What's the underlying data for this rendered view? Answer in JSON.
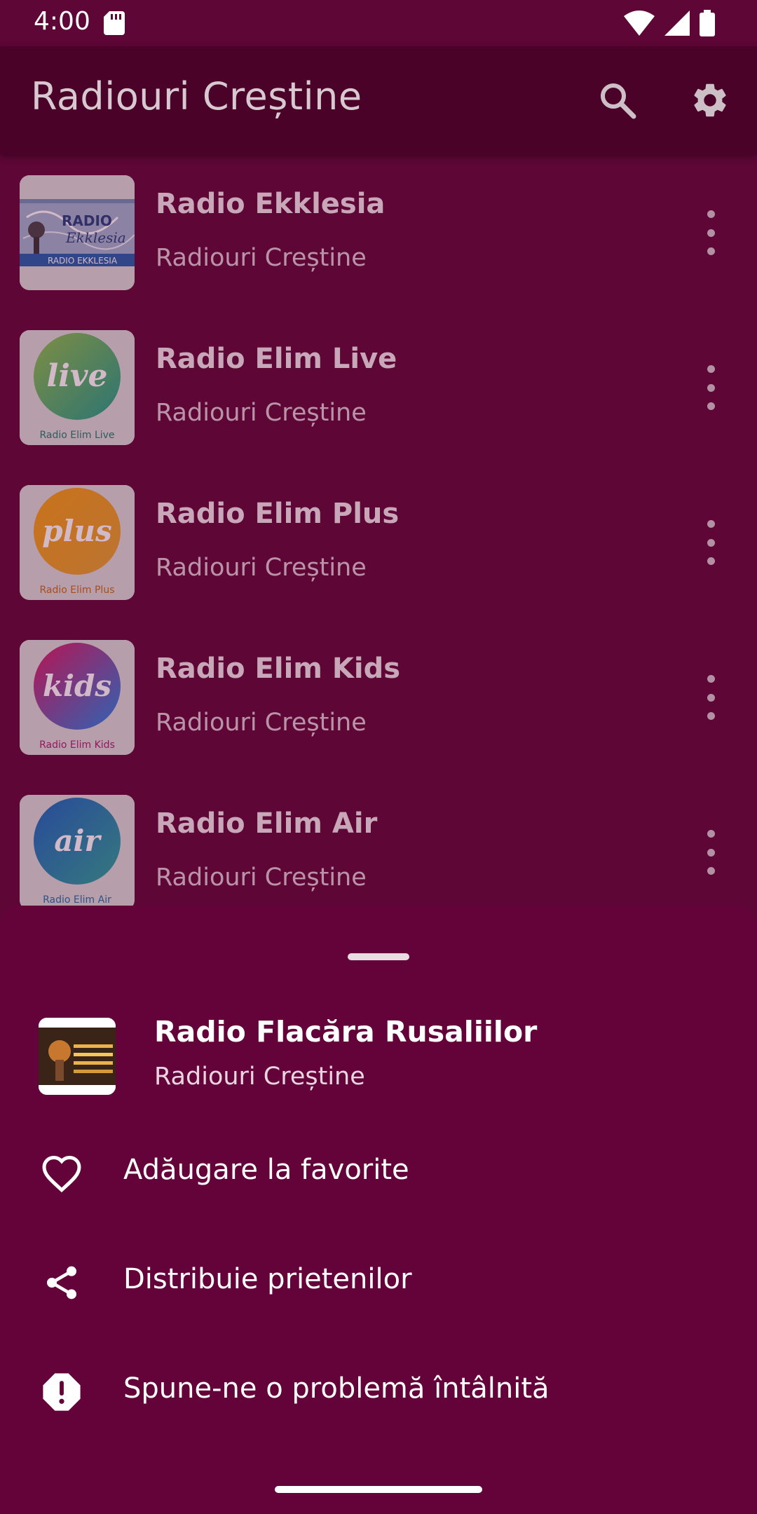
{
  "status": {
    "time": "4:00"
  },
  "app_bar": {
    "title": "Radiouri Creștine"
  },
  "stations": [
    {
      "title": "Radio Ekklesia",
      "subtitle": "Radiouri Creștine",
      "logo_text": "RADIO EKKLESIA",
      "logo_color": "#1f5fa8"
    },
    {
      "title": "Radio Elim Live",
      "subtitle": "Radiouri Creștine",
      "logo_word": "live",
      "logo_caption": "Radio Elim Live",
      "logo_color": "#4caf50"
    },
    {
      "title": "Radio Elim Plus",
      "subtitle": "Radiouri Creștine",
      "logo_word": "plus",
      "logo_caption": "Radio Elim Plus",
      "logo_color": "#f08a1c"
    },
    {
      "title": "Radio Elim Kids",
      "subtitle": "Radiouri Creștine",
      "logo_word": "kids",
      "logo_caption": "Radio Elim Kids",
      "logo_color": "#b43aa0"
    },
    {
      "title": "Radio Elim Air",
      "subtitle": "Radiouri Creștine",
      "logo_word": "air",
      "logo_caption": "Radio Elim Air",
      "logo_color": "#2a7fb8"
    }
  ],
  "sheet": {
    "station_title": "Radio Flacăra Rusaliilor",
    "station_subtitle": "Radiouri Creștine",
    "actions": [
      {
        "label": "Adăugare la favorite",
        "icon": "heart-outline-icon"
      },
      {
        "label": "Distribuie prietenilor",
        "icon": "share-icon"
      },
      {
        "label": "Spune-ne o problemă întâlnită",
        "icon": "alert-octagon-icon"
      }
    ]
  },
  "colors": {
    "background": "#5e0636",
    "app_bar": "#4a0228",
    "sheet": "#64023a"
  }
}
